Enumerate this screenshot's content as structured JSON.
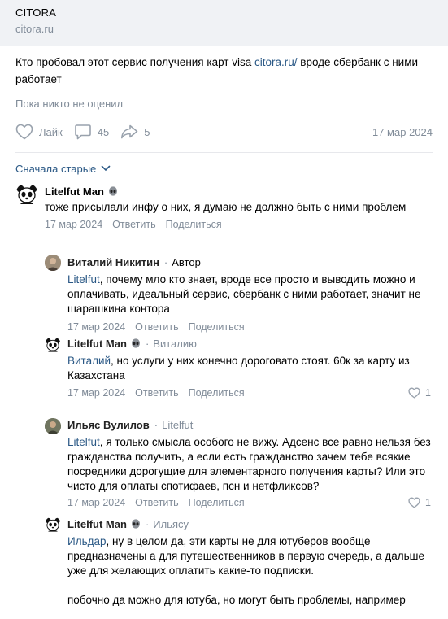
{
  "link": {
    "title": "CITORA",
    "domain": "citora.ru"
  },
  "post": {
    "text_before": "Кто пробовал этот сервис получения карт visa ",
    "text_link": "citora.ru/",
    "text_after": " вроде сбербанк с ними работает",
    "rating": "Пока никто не оценил",
    "like_label": "Лайк",
    "comments_count": "45",
    "shares_count": "5",
    "date": "17 мар 2024"
  },
  "sort_label": "Сначала старые",
  "comments": [
    {
      "author": "Litelfut Man",
      "text": "тоже присылали инфу о них, я думаю не должно быть с ними проблем",
      "date": "17 мар 2024",
      "reply": "Ответить",
      "share": "Поделиться"
    },
    {
      "author": "Виталий Никитин",
      "author_badge": "Автор",
      "mention": "Litelfut",
      "text": ", почему мло кто знает, вроде все просто и выводить можно и оплачивать, идеальный сервис, сбербанк с ними работает, значит не шарашкина контора",
      "date": "17 мар 2024",
      "reply": "Ответить",
      "share": "Поделиться"
    },
    {
      "author": "Litelfut Man",
      "reply_to": "Виталию",
      "mention": "Виталий",
      "text": ", но услуги у них конечно дороговато стоят. 60к за карту из Казахстана",
      "date": "17 мар 2024",
      "reply": "Ответить",
      "share": "Поделиться",
      "likes": "1"
    },
    {
      "author": "Ильяс Вулилов",
      "reply_to": "Litelfut",
      "mention": "Litelfut",
      "text": ", я только смысла особого не вижу. Адсенс все равно нельзя без гражданства получить, а если есть гражданство зачем тебе всякие посредники дорогущие для элементарного получения карты? Или это чисто для оплаты спотифаев, псн и нетфликсов?",
      "date": "17 мар 2024",
      "reply": "Ответить",
      "share": "Поделиться",
      "likes": "1"
    },
    {
      "author": "Litelfut Man",
      "reply_to": "Ильясу",
      "mention": "Ильдар",
      "text": ", ну в целом да, эти карты не для ютуберов вообще предназначены а для путешественников в первую очередь, а дальше уже для желающих оплатить какие-то подписки.",
      "text2": "побочно да можно для ютуба, но могут быть проблемы, например"
    }
  ],
  "colors": {
    "link": "#2a5885",
    "muted": "#818c99",
    "header_bg": "#f0f2f5",
    "divider": "#e7e8ec"
  }
}
